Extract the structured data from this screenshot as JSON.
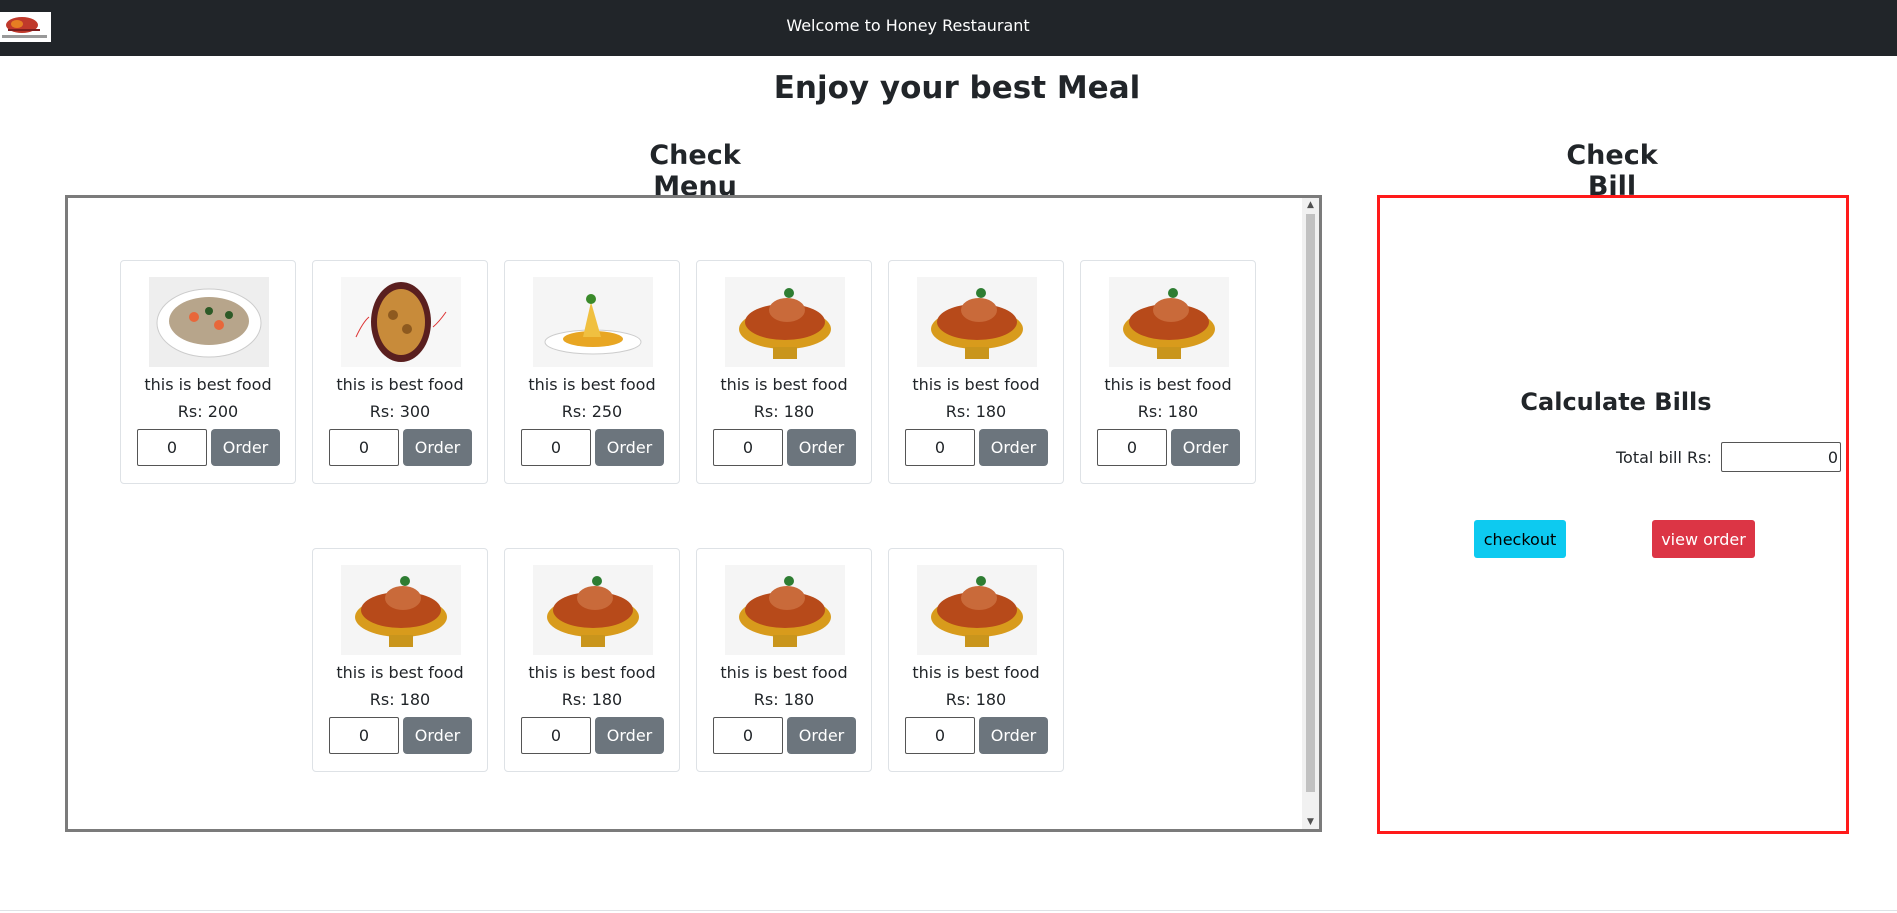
{
  "navbar": {
    "title": "Welcome to Honey Restaurant"
  },
  "page": {
    "title": "Enjoy your best Meal",
    "menu_title": "Check Menu",
    "bill_title": "Check Bill"
  },
  "menu": {
    "items": [
      {
        "name": "this is best food",
        "price": "Rs: 200",
        "qty": "0",
        "order_label": "Order",
        "image": "plate-image"
      },
      {
        "name": "this is best food",
        "price": "Rs: 300",
        "qty": "0",
        "order_label": "Order",
        "image": "curry-image"
      },
      {
        "name": "this is best food",
        "price": "Rs: 250",
        "qty": "0",
        "order_label": "Order",
        "image": "dish-image"
      },
      {
        "name": "this is best food",
        "price": "Rs: 180",
        "qty": "0",
        "order_label": "Order",
        "image": "chickpea-image"
      },
      {
        "name": "this is best food",
        "price": "Rs: 180",
        "qty": "0",
        "order_label": "Order",
        "image": "chickpea-image"
      },
      {
        "name": "this is best food",
        "price": "Rs: 180",
        "qty": "0",
        "order_label": "Order",
        "image": "chickpea-image"
      },
      {
        "name": "this is best food",
        "price": "Rs: 180",
        "qty": "0",
        "order_label": "Order",
        "image": "chickpea-image"
      },
      {
        "name": "this is best food",
        "price": "Rs: 180",
        "qty": "0",
        "order_label": "Order",
        "image": "chickpea-image"
      },
      {
        "name": "this is best food",
        "price": "Rs: 180",
        "qty": "0",
        "order_label": "Order",
        "image": "chickpea-image"
      },
      {
        "name": "this is best food",
        "price": "Rs: 180",
        "qty": "0",
        "order_label": "Order",
        "image": "chickpea-image"
      }
    ]
  },
  "bill": {
    "heading": "Calculate Bills",
    "total_label": "Total bill Rs:",
    "total_value": "0",
    "checkout_label": "checkout",
    "view_order_label": "view order"
  },
  "colors": {
    "navbar": "#212529",
    "order_button": "#6c757d",
    "checkout_button": "#0dcaf0",
    "view_order_button": "#dc3545",
    "bill_border": "#ff1a1a"
  }
}
